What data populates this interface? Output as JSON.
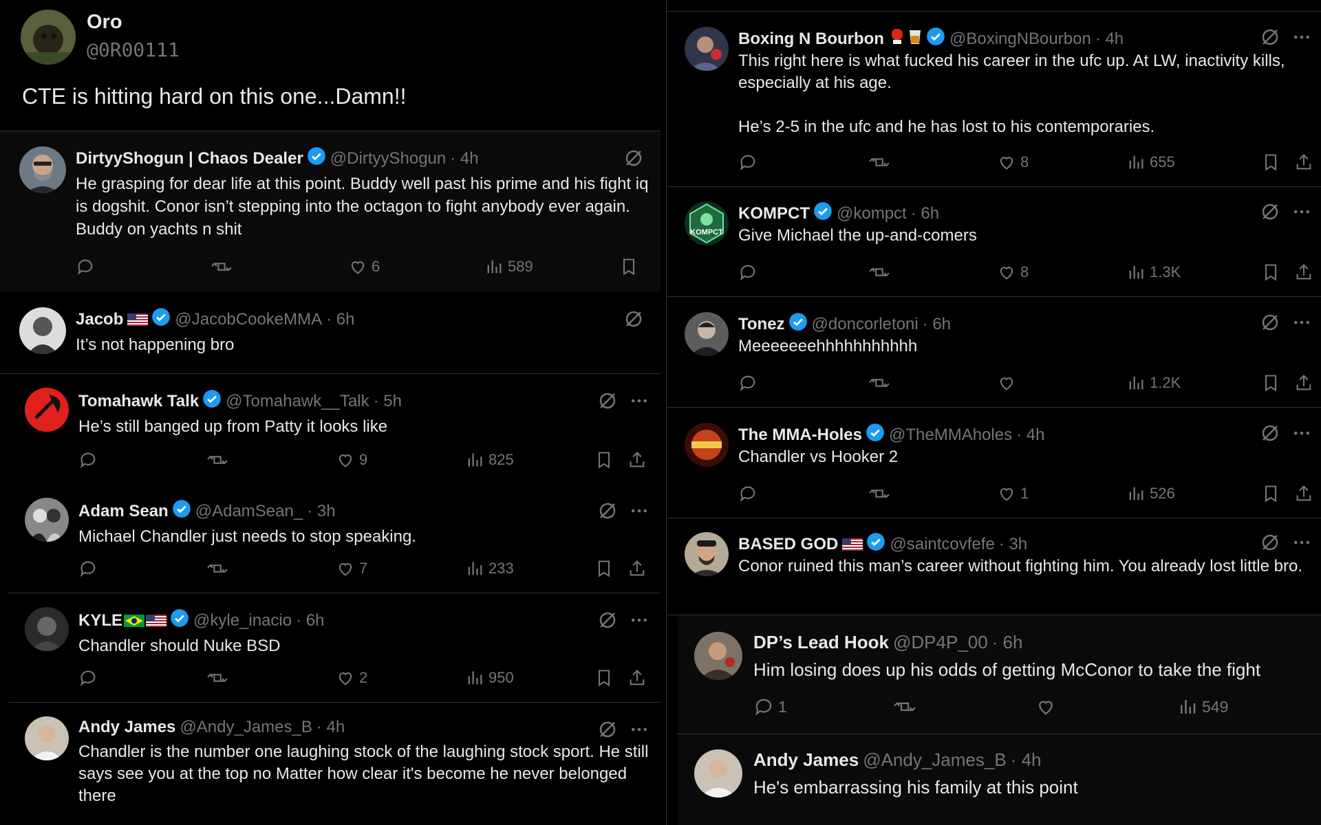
{
  "main_post": {
    "name": "Oro",
    "handle": "@0R00111",
    "text": "CTE is hitting hard on this one...Damn!!"
  },
  "left_column": [
    {
      "name": "DirtyyShogun | Chaos Dealer",
      "handle": "@DirtyyShogun",
      "time": "· 4h",
      "text": "He grasping for dear life at this point. Buddy well past his prime and his fight iq is dogshit. Conor isn’t stepping into the octagon to fight anybody ever again. Buddy on yachts n shit",
      "likes": "6",
      "views": "589"
    },
    {
      "name": "Jacob",
      "handle": "@JacobCookeMMA",
      "time": "· 6h",
      "text": "It’s not happening bro"
    },
    {
      "name": "Tomahawk Talk",
      "handle": "@Tomahawk__Talk",
      "time": "· 5h",
      "text": "He’s still banged up from Patty it looks like",
      "likes": "9",
      "views": "825"
    },
    {
      "name": "Adam Sean",
      "handle": "@AdamSean_",
      "time": "· 3h",
      "text": "Michael Chandler just needs to stop speaking.",
      "likes": "7",
      "views": "233"
    },
    {
      "name": "KYLE",
      "handle": "@kyle_inacio",
      "time": "· 6h",
      "text": "Chandler should Nuke BSD",
      "likes": "2",
      "views": "950"
    },
    {
      "name": "Andy James",
      "handle": "@Andy_James_B",
      "time": "· 4h",
      "text": "Chandler is the number one laughing stock of the laughing stock sport. He still says see you at the top no Matter how clear it's become he never belonged there"
    }
  ],
  "right_column": [
    {
      "name": "Boxing N Bourbon",
      "handle": "@BoxingNBourbon",
      "time": "· 4h",
      "text": "This right here is what fucked his career in the ufc up. At LW, inactivity kills, especially at his age.\n\nHe’s 2-5 in the ufc and he has lost to his contemporaries.",
      "likes": "8",
      "views": "655"
    },
    {
      "name": "KOMPCT",
      "handle": "@kompct",
      "time": "· 6h",
      "text": "Give Michael the up-and-comers",
      "likes": "8",
      "views": "1.3K",
      "avatar_text": "KOMPCT"
    },
    {
      "name": "Tonez",
      "handle": "@doncorletoni",
      "time": "· 6h",
      "text": "Meeeeeeehhhhhhhhhhh",
      "views": "1.2K"
    },
    {
      "name": "The MMA-Holes",
      "handle": "@TheMMAholes",
      "time": "· 4h",
      "text": "Chandler vs Hooker 2",
      "likes": "1",
      "views": "526"
    },
    {
      "name": "BASED GOD",
      "handle": "@saintcovfefe",
      "time": "· 3h",
      "text": "Conor ruined this man’s career without fighting him. You already lost little bro."
    },
    {
      "name": "DP’s Lead Hook",
      "handle": "@DP4P_00",
      "time": "· 6h",
      "text": "Him losing does up his odds of getting McConor to take the fight",
      "replies": "1",
      "views": "549"
    },
    {
      "name": "Andy James",
      "handle": "@Andy_James_B",
      "time": "· 4h",
      "text": "He's embarrassing his family at this point"
    }
  ],
  "colors": {
    "background": "#000000",
    "card": "#0a0a0a",
    "text": "#e7e9ea",
    "muted": "#71767b",
    "verified": "#1d9bf0",
    "divider": "#2f3336"
  }
}
